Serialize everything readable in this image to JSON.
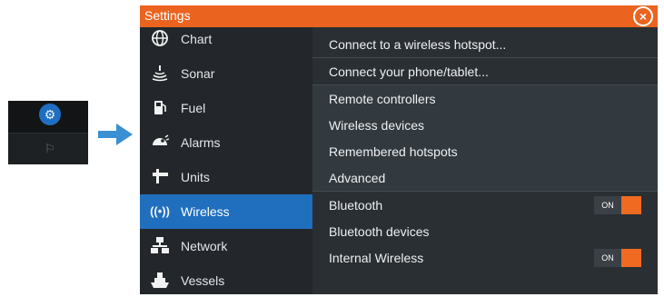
{
  "settings": {
    "title": "Settings",
    "close_icon": "close-circle-icon"
  },
  "sidebar": {
    "items": [
      {
        "label": "Chart",
        "icon": "globe-icon"
      },
      {
        "label": "Sonar",
        "icon": "sonar-icon"
      },
      {
        "label": "Fuel",
        "icon": "fuel-pump-icon"
      },
      {
        "label": "Alarms",
        "icon": "alarm-icon"
      },
      {
        "label": "Units",
        "icon": "units-icon"
      },
      {
        "label": "Wireless",
        "icon": "wireless-icon",
        "selected": true
      },
      {
        "label": "Network",
        "icon": "network-icon"
      },
      {
        "label": "Vessels",
        "icon": "vessels-icon"
      }
    ]
  },
  "wireless": {
    "items": [
      {
        "label": "Connect to a wireless hotspot..."
      },
      {
        "label": "Connect your phone/tablet..."
      },
      {
        "label": "Remote controllers"
      },
      {
        "label": "Wireless devices"
      },
      {
        "label": "Remembered hotspots"
      },
      {
        "label": "Advanced"
      },
      {
        "label": "Bluetooth",
        "toggle": "ON"
      },
      {
        "label": "Bluetooth devices"
      },
      {
        "label": "Internal Wireless",
        "toggle": "ON"
      }
    ]
  },
  "colors": {
    "accent": "#ea6420",
    "selected": "#1f6fbe",
    "arrow": "#3b8fd3"
  }
}
